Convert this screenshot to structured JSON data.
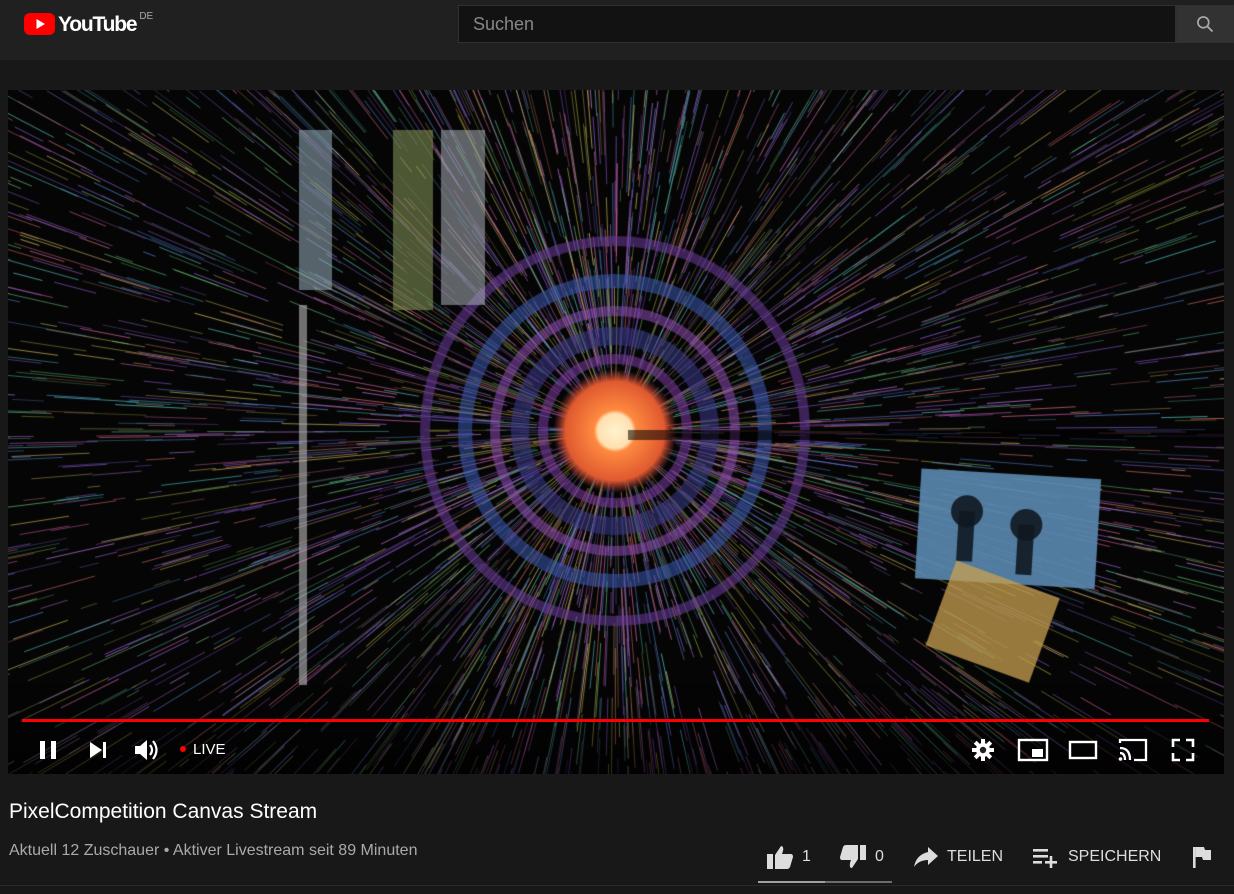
{
  "header": {
    "logo_text": "YouTube",
    "country_code": "DE",
    "search_placeholder": "Suchen"
  },
  "player": {
    "live_label": "LIVE",
    "progress_fraction": 1.0,
    "colors": {
      "progress": "#ff0000",
      "live_dot": "#ff0000"
    },
    "icons": [
      "pause-icon",
      "next-icon",
      "volume-icon",
      "settings-gear-icon",
      "miniplayer-icon",
      "theater-mode-icon",
      "cast-icon",
      "fullscreen-icon"
    ]
  },
  "video": {
    "title": "PixelCompetition Canvas Stream",
    "meta": "Aktuell 12 Zuschauer • Aktiver Livestream seit 89 Minuten"
  },
  "actions": {
    "like_count": "1",
    "dislike_count": "0",
    "share_label": "TEILEN",
    "save_label": "SPEICHERN"
  }
}
